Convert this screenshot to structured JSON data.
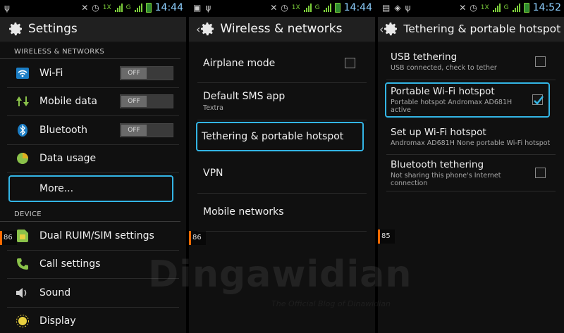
{
  "status": {
    "p1_time": "14:44",
    "p2_time": "14:44",
    "p3_time": "14:52",
    "network_type": "1X",
    "network_g": "G"
  },
  "panel1": {
    "title": "Settings",
    "section_wireless": "WIRELESS & NETWORKS",
    "section_device": "DEVICE",
    "items": [
      {
        "label": "Wi-Fi",
        "toggle": "OFF"
      },
      {
        "label": "Mobile data",
        "toggle": "OFF"
      },
      {
        "label": "Bluetooth",
        "toggle": "OFF"
      },
      {
        "label": "Data usage"
      },
      {
        "label": "More..."
      }
    ],
    "device_items": [
      {
        "label": "Dual RUIM/SIM settings"
      },
      {
        "label": "Call settings"
      },
      {
        "label": "Sound"
      },
      {
        "label": "Display"
      }
    ],
    "edge_number": "86"
  },
  "panel2": {
    "title": "Wireless & networks",
    "items": [
      {
        "label": "Airplane mode",
        "sub": ""
      },
      {
        "label": "Default SMS app",
        "sub": "Textra"
      },
      {
        "label": "Tethering & portable hotspot",
        "sub": ""
      },
      {
        "label": "VPN",
        "sub": ""
      },
      {
        "label": "Mobile networks",
        "sub": ""
      }
    ],
    "edge_number": "86"
  },
  "panel3": {
    "title": "Tethering & portable hotspot",
    "items": [
      {
        "label": "USB tethering",
        "sub": "USB connected, check to tether",
        "checked": false
      },
      {
        "label": "Portable Wi-Fi hotspot",
        "sub": "Portable hotspot Andromax AD681H active",
        "checked": true
      },
      {
        "label": "Set up Wi-Fi hotspot",
        "sub": "Andromax AD681H None portable Wi-Fi hotspot"
      },
      {
        "label": "Bluetooth tethering",
        "sub": "Not sharing this phone's Internet connection",
        "checked": false
      }
    ],
    "edge_number": "85"
  },
  "watermark": {
    "text": "Dingawidian",
    "sub": "The Official Blog of Dinawidian"
  },
  "colors": {
    "accent": "#33b5e5",
    "wifi": "#33b5e5",
    "mobile_data": "#8ac24a",
    "bluetooth": "#33b5e5",
    "data_usage": "#8ac24a",
    "edge_marker": "#ff6a00"
  }
}
